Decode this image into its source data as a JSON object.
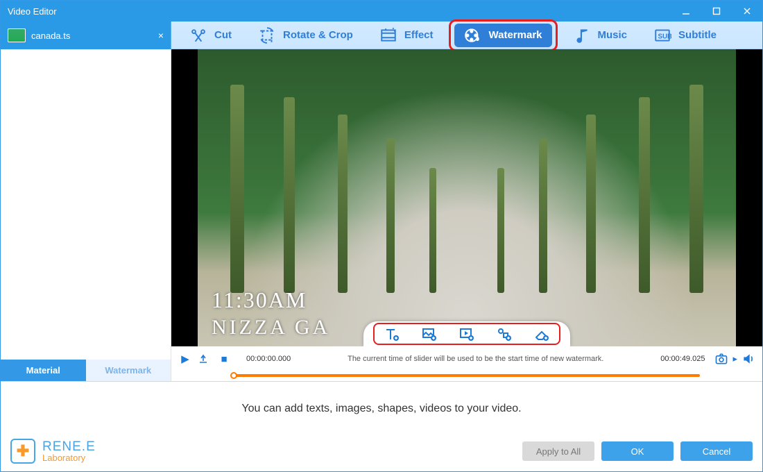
{
  "window": {
    "title": "Video Editor"
  },
  "file_tabs": [
    {
      "name": "canada.ts"
    }
  ],
  "toolbar": {
    "items": [
      {
        "id": "cut",
        "label": "Cut",
        "icon": "scissors-icon"
      },
      {
        "id": "rotatecrop",
        "label": "Rotate & Crop",
        "icon": "crop-rotate-icon"
      },
      {
        "id": "effect",
        "label": "Effect",
        "icon": "filmstrip-sparkle-icon"
      },
      {
        "id": "watermark",
        "label": "Watermark",
        "icon": "reel-droplet-icon",
        "active": true,
        "highlighted": true
      },
      {
        "id": "music",
        "label": "Music",
        "icon": "music-note-icon"
      },
      {
        "id": "subtitle",
        "label": "Subtitle",
        "icon": "subtitle-icon"
      }
    ]
  },
  "sidebar_tabs": {
    "material": "Material",
    "watermark": "Watermark",
    "active": "material"
  },
  "preview": {
    "overlay_time_text": "11:30AM",
    "overlay_title_text": "NIZZA GA"
  },
  "watermark_tools": [
    {
      "id": "add-text",
      "icon": "text-plus-icon"
    },
    {
      "id": "add-image",
      "icon": "image-plus-icon"
    },
    {
      "id": "add-video",
      "icon": "video-plus-icon"
    },
    {
      "id": "add-shape",
      "icon": "shape-plus-icon"
    },
    {
      "id": "eraser",
      "icon": "eraser-plus-icon"
    }
  ],
  "transport": {
    "current_time": "00:00:00.000",
    "end_time": "00:00:49.025",
    "hint": "The current time of slider will be used to be the start time of new watermark."
  },
  "footer": {
    "center_hint": "You can add texts, images, shapes, videos to your video.",
    "brand_line1": "RENE.E",
    "brand_line2": "Laboratory",
    "apply_all": "Apply to All",
    "ok": "OK",
    "cancel": "Cancel"
  },
  "colors": {
    "accent": "#2a9ae6",
    "toolbar_text": "#2f7ed8",
    "highlight_red": "#e71e1e",
    "slider_orange": "#ff7a00"
  }
}
